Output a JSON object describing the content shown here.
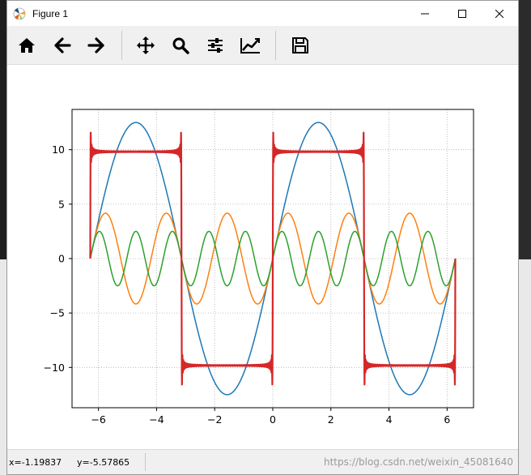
{
  "window": {
    "title": "Figure 1",
    "controls": [
      "minimize-icon",
      "maximize-icon",
      "close-icon"
    ]
  },
  "toolbar": {
    "buttons": [
      {
        "name": "home",
        "icon": "home-icon"
      },
      {
        "name": "back",
        "icon": "arrow-left-icon"
      },
      {
        "name": "forward",
        "icon": "arrow-right-icon"
      },
      {
        "name": "pan",
        "icon": "move-icon"
      },
      {
        "name": "zoom",
        "icon": "magnifier-icon"
      },
      {
        "name": "subplots",
        "icon": "sliders-icon"
      },
      {
        "name": "edit-axes",
        "icon": "chart-line-icon"
      },
      {
        "name": "save",
        "icon": "floppy-disk-icon"
      }
    ]
  },
  "status": {
    "x": "x=-1.19837",
    "y": "y=-5.57865",
    "watermark": "https://blog.csdn.net/weixin_45081640"
  },
  "chart_data": {
    "type": "line",
    "title": "",
    "xlabel": "",
    "ylabel": "",
    "xlim": [
      -6.91,
      6.91
    ],
    "ylim": [
      -13.7,
      13.7
    ],
    "xticks": [
      -6,
      -4,
      -2,
      0,
      2,
      4,
      6
    ],
    "yticks": [
      -10,
      -5,
      0,
      5,
      10
    ],
    "grid": true,
    "grid_style": "dotted",
    "x": {
      "start": -6.2832,
      "end": 6.2832
    },
    "series": [
      {
        "color": "#1f77b4",
        "expression": "12.5*sin(x)",
        "peak_value": 12.5
      },
      {
        "color": "#ff7f0e",
        "expression": "4.17*sin(3*x)",
        "peak_value": 4.17
      },
      {
        "color": "#2ca02c",
        "expression": "2.5*sin(5*x)",
        "peak_value": 2.5
      },
      {
        "color": "#d62728",
        "expression": "square wave ±9.8 (Fourier sum)",
        "peak_value": 9.8,
        "linewidth": "thick"
      }
    ]
  }
}
